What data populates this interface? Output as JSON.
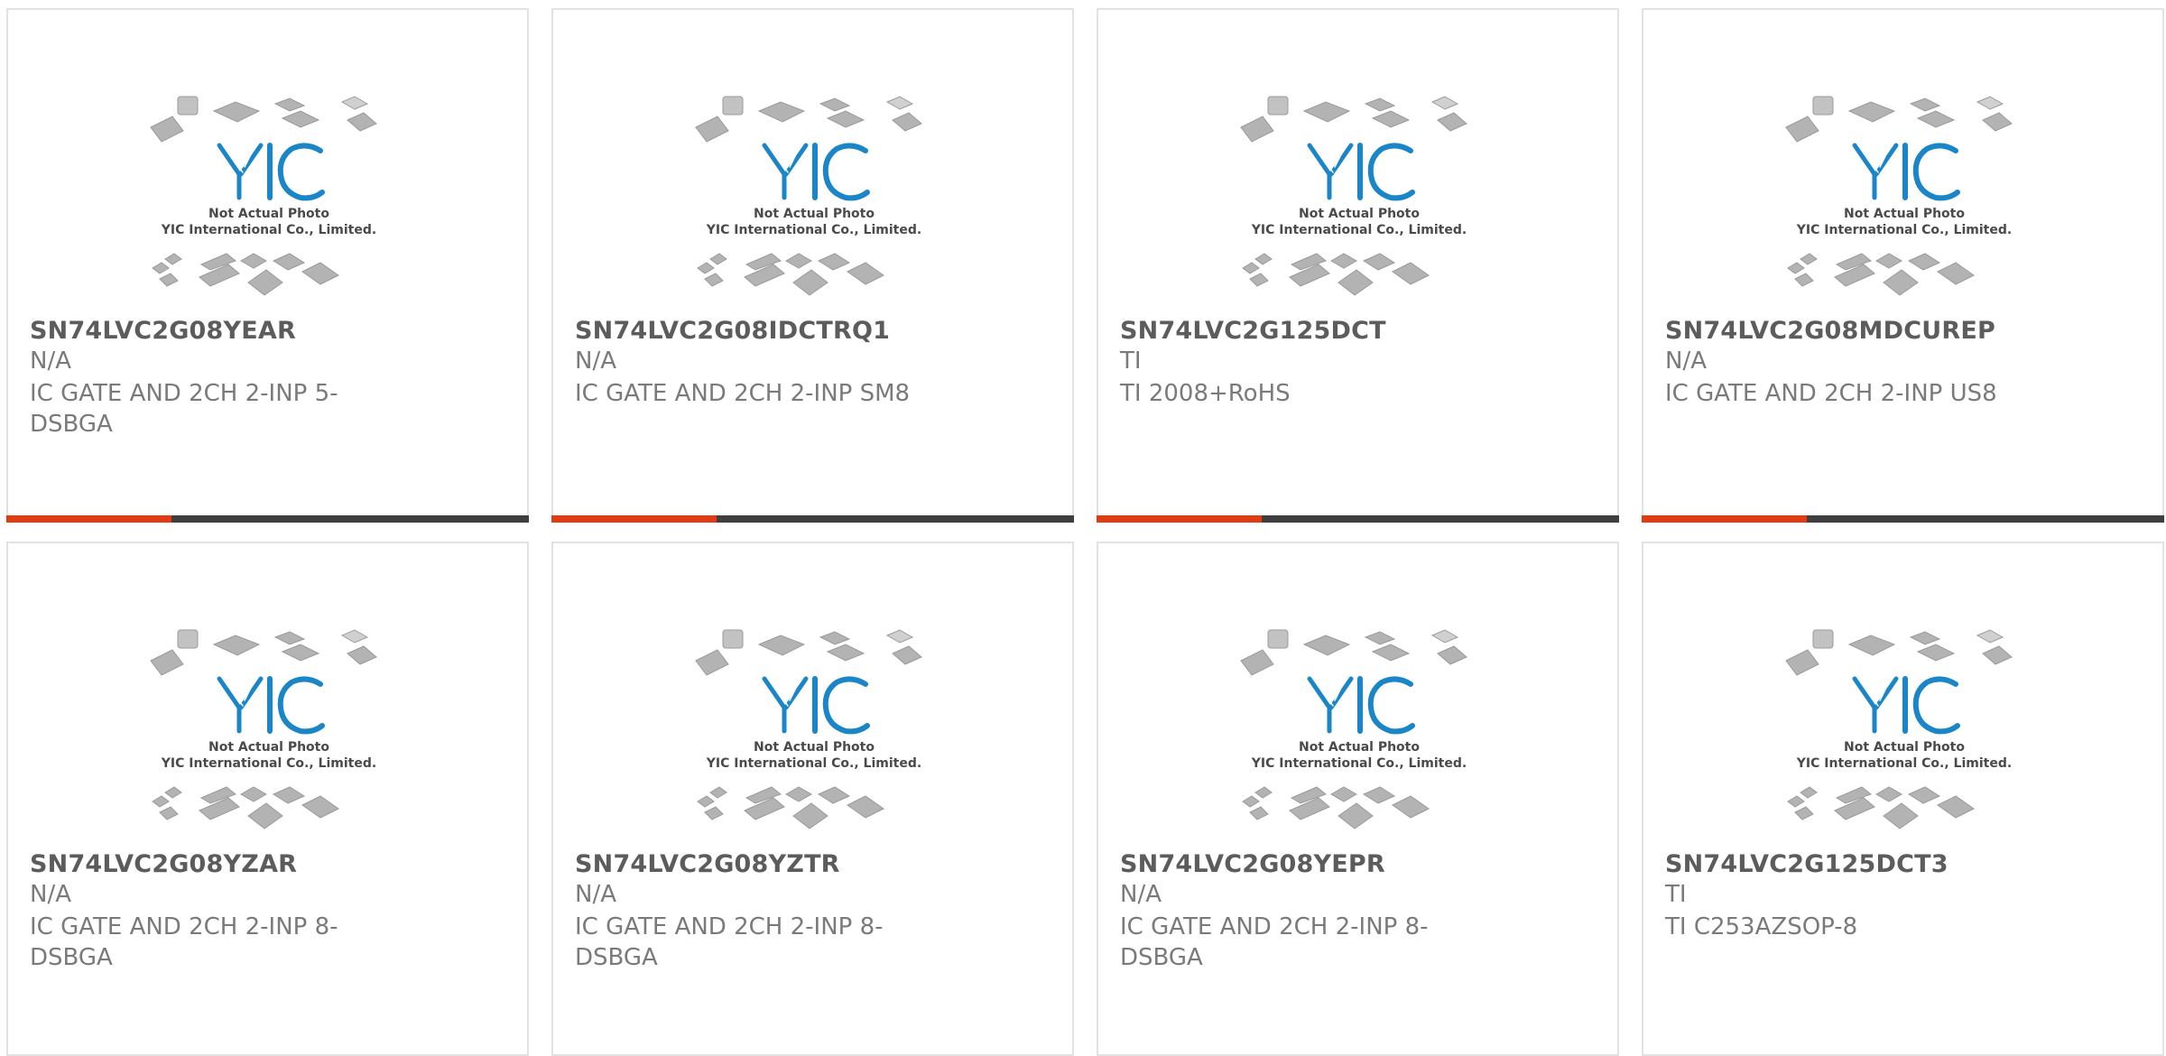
{
  "placeholder": {
    "line1": "Not Actual Photo",
    "line2": "YIC International Co., Limited.",
    "logo_text": "YIC",
    "logo_color": "#1a86c8"
  },
  "colors": {
    "accent": "#e23a12",
    "bar": "#3e3e3e",
    "part": "#5c5c5c",
    "text": "#7a7a7a",
    "border": "#e2e2e2"
  },
  "products": [
    {
      "part": "SN74LVC2G08YEAR",
      "brand": "N/A",
      "desc": "IC GATE AND 2CH 2-INP 5-DSBGA"
    },
    {
      "part": "SN74LVC2G08IDCTRQ1",
      "brand": "N/A",
      "desc": "IC GATE AND 2CH 2-INP SM8"
    },
    {
      "part": "SN74LVC2G125DCT",
      "brand": "TI",
      "desc": "TI 2008+RoHS"
    },
    {
      "part": "SN74LVC2G08MDCUREP",
      "brand": "N/A",
      "desc": "IC GATE AND 2CH 2-INP US8"
    },
    {
      "part": "SN74LVC2G08YZAR",
      "brand": "N/A",
      "desc": "IC GATE AND 2CH 2-INP 8-DSBGA"
    },
    {
      "part": "SN74LVC2G08YZTR",
      "brand": "N/A",
      "desc": "IC GATE AND 2CH 2-INP 8-DSBGA"
    },
    {
      "part": "SN74LVC2G08YEPR",
      "brand": "N/A",
      "desc": "IC GATE AND 2CH 2-INP 8-DSBGA"
    },
    {
      "part": "SN74LVC2G125DCT3",
      "brand": "TI",
      "desc": "TI C253AZSOP-8"
    }
  ]
}
